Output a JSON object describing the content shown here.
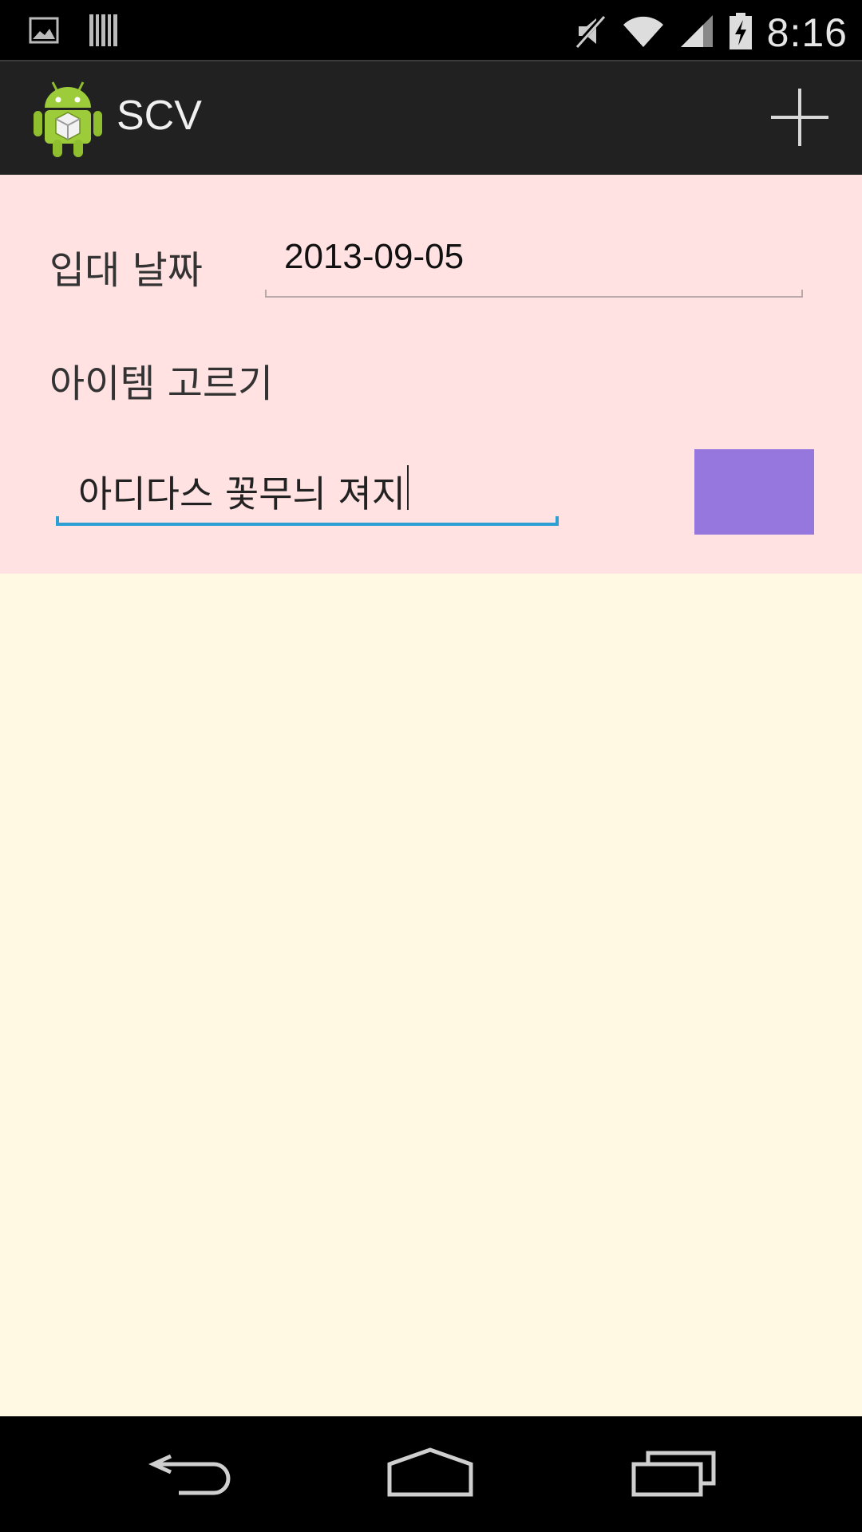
{
  "status_bar": {
    "time": "8:16",
    "icons": [
      "image-notification-icon",
      "barcode-icon",
      "muted-icon",
      "wifi-icon",
      "signal-icon",
      "battery-charging-icon"
    ]
  },
  "action_bar": {
    "title": "SCV",
    "app_icon": "android-app-icon",
    "add_icon": "plus-icon"
  },
  "form": {
    "date_label": "입대 날짜",
    "date_value": "2013-09-05",
    "item_label": "아이템 고르기",
    "item_value": "아디다스 꽃무늬 져지",
    "swatch_color": "#9677dd"
  },
  "nav_bar": {
    "icons": [
      "back-icon",
      "home-icon",
      "recent-apps-icon"
    ]
  },
  "colors": {
    "form_bg": "#ffe2e1",
    "page_bg": "#fff8e3",
    "accent": "#2d9fd3"
  }
}
